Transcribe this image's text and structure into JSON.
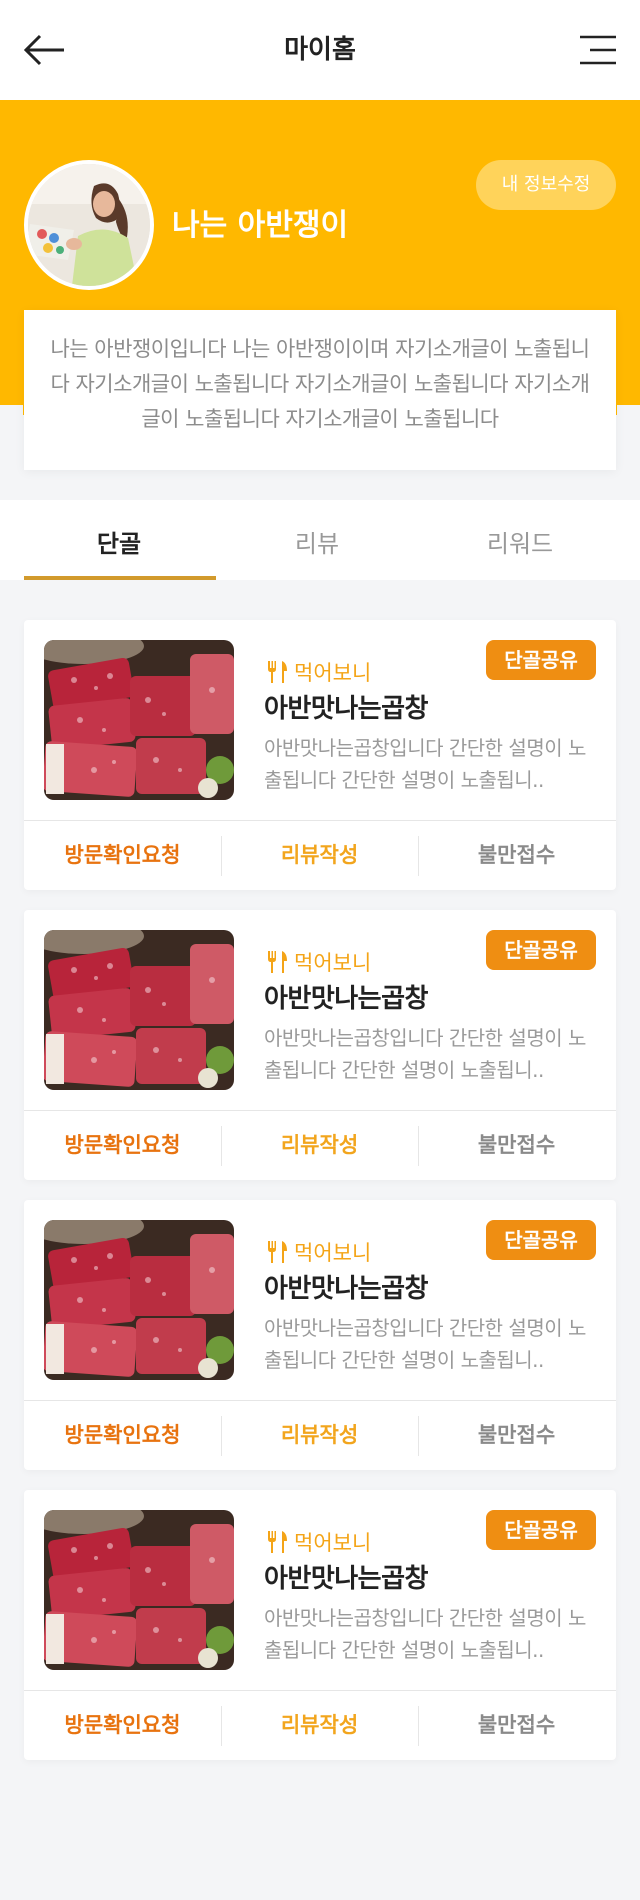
{
  "header": {
    "title": "마이홈"
  },
  "colors": {
    "accent": "#ffb800",
    "orange": "#ef8e12",
    "text": "#222222"
  },
  "profile": {
    "nickname": "나는 아반쟁이",
    "edit_label": "내 정보수정",
    "intro": "나는 아반쟁이입니다 나는 아반쟁이이며 자기소개글이 노출됩니다 자기소개글이 노출됩니다 자기소개글이 노출됩니다 자기소개글이 노출됩니다 자기소개글이 노출됩니다"
  },
  "tabs": [
    {
      "label": "단골",
      "active": true
    },
    {
      "label": "리뷰",
      "active": false
    },
    {
      "label": "리워드",
      "active": false
    }
  ],
  "cards": [
    {
      "badge": "단골공유",
      "category": "먹어보니",
      "name": "아반맛나는곱창",
      "desc": "아반맛나는곱창입니다 간단한 설명이 노출됩니다 간단한 설명이 노출됩니..",
      "actions": [
        "방문확인요청",
        "리뷰작성",
        "불만접수"
      ]
    },
    {
      "badge": "단골공유",
      "category": "먹어보니",
      "name": "아반맛나는곱창",
      "desc": "아반맛나는곱창입니다 간단한 설명이 노출됩니다 간단한 설명이 노출됩니..",
      "actions": [
        "방문확인요청",
        "리뷰작성",
        "불만접수"
      ]
    },
    {
      "badge": "단골공유",
      "category": "먹어보니",
      "name": "아반맛나는곱창",
      "desc": "아반맛나는곱창입니다 간단한 설명이 노출됩니다 간단한 설명이 노출됩니..",
      "actions": [
        "방문확인요청",
        "리뷰작성",
        "불만접수"
      ]
    },
    {
      "badge": "단골공유",
      "category": "먹어보니",
      "name": "아반맛나는곱창",
      "desc": "아반맛나는곱창입니다 간단한 설명이 노출됩니다 간단한 설명이 노출됩니..",
      "actions": [
        "방문확인요청",
        "리뷰작성",
        "불만접수"
      ]
    }
  ],
  "icons": {
    "back": "arrow-left-icon",
    "menu": "hamburger-menu-icon",
    "category": "fork-knife-icon"
  }
}
